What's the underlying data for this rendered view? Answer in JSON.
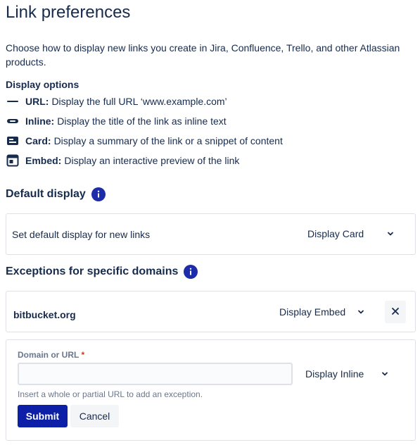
{
  "title": "Link preferences",
  "description": "Choose how to display new links you create in Jira, Confluence, Trello, and other Atlassian products.",
  "display_options": {
    "heading": "Display options",
    "items": [
      {
        "name": "URL:",
        "text": "Display the full URL ‘www.example.com’",
        "icon": "url-icon"
      },
      {
        "name": "Inline:",
        "text": "Display the title of the link as inline text",
        "icon": "inline-icon"
      },
      {
        "name": "Card:",
        "text": "Display a summary of the link or a snippet of content",
        "icon": "card-icon"
      },
      {
        "name": "Embed:",
        "text": "Display an interactive preview of the link",
        "icon": "embed-icon"
      }
    ]
  },
  "default_display": {
    "heading": "Default display",
    "label": "Set default display for new links",
    "selected": "Display Card"
  },
  "exceptions": {
    "heading": "Exceptions for specific domains",
    "items": [
      {
        "domain": "bitbucket.org",
        "display": "Display Embed"
      }
    ],
    "form": {
      "label": "Domain or URL",
      "required_mark": "*",
      "value": "",
      "placeholder": "",
      "display": "Display Inline",
      "helper": "Insert a whole or partial URL to add an exception.",
      "submit_label": "Submit",
      "cancel_label": "Cancel"
    }
  },
  "colors": {
    "primary": "#0c1fa6",
    "info": "#1d2ca8",
    "text": "#172b4d",
    "subtle": "#6b778c",
    "border": "#dfe1e6"
  }
}
